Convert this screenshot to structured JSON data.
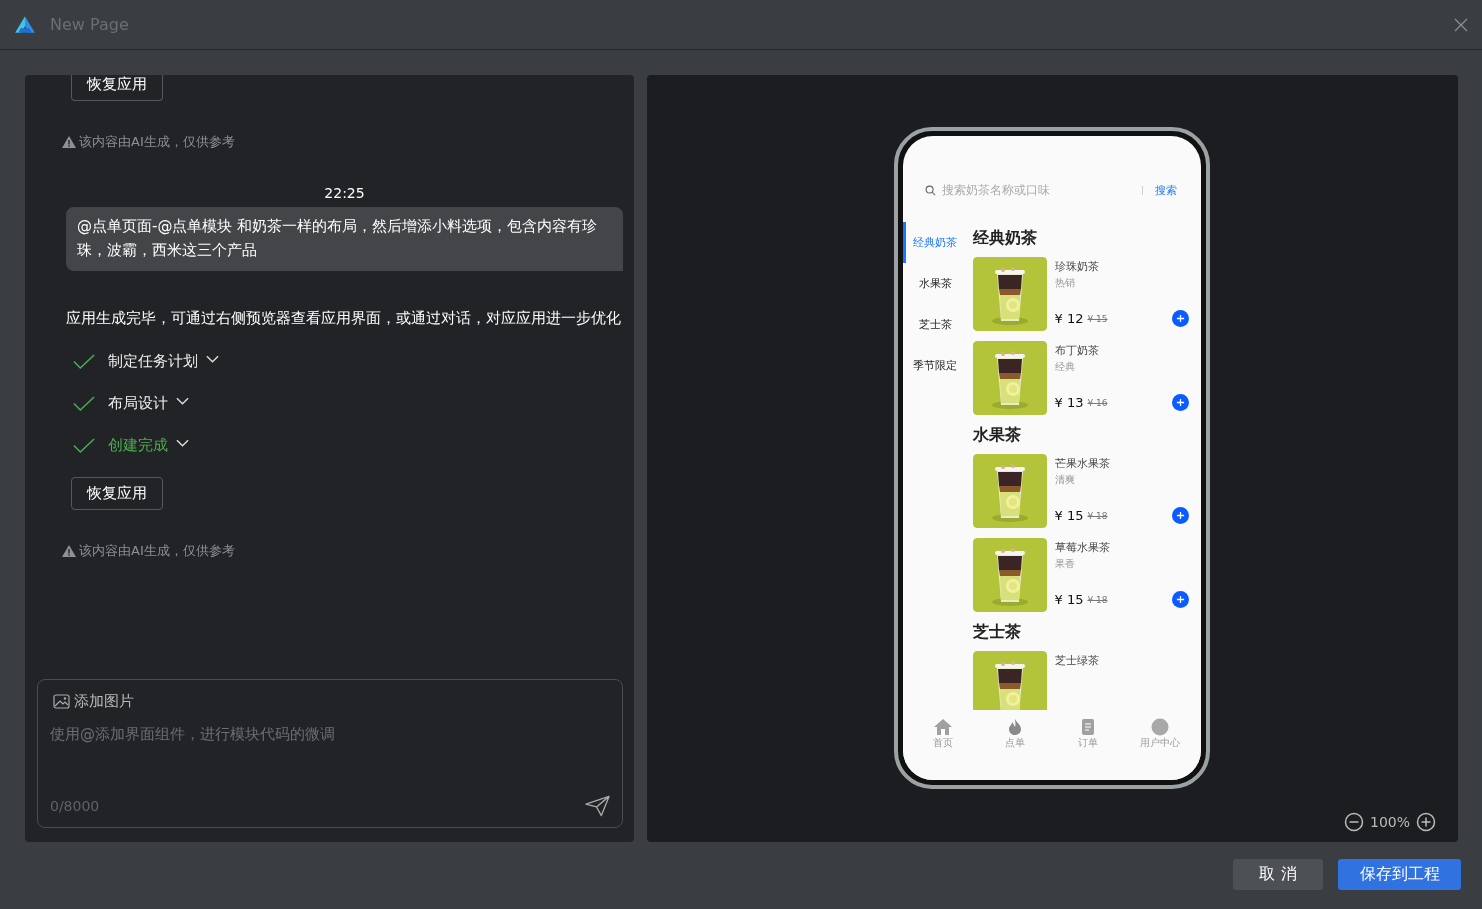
{
  "window": {
    "title": "New Page"
  },
  "chat": {
    "messages": [
      {
        "kind": "restore",
        "label": "恢复应用"
      },
      {
        "kind": "notice",
        "text": "该内容由AI生成，仅供参考"
      },
      {
        "kind": "time",
        "text": "22:25"
      },
      {
        "kind": "user",
        "text": "@点单页面-@点单模块 和奶茶一样的布局，然后增添小料选项，包含内容有珍珠，波霸，西米这三个产品"
      },
      {
        "kind": "reply",
        "text": "应用生成完毕，可通过右侧预览器查看应用界面，或通过对话，对应应用进一步优化"
      },
      {
        "kind": "step",
        "label": "制定任务计划",
        "done": true,
        "active": false
      },
      {
        "kind": "step",
        "label": "布局设计",
        "done": true,
        "active": false
      },
      {
        "kind": "step",
        "label": "创建完成",
        "done": true,
        "active": true
      },
      {
        "kind": "restore",
        "label": "恢复应用"
      },
      {
        "kind": "notice",
        "text": "该内容由AI生成，仅供参考"
      }
    ]
  },
  "composer": {
    "attach_label": "添加图片",
    "placeholder": "使用@添加界面组件，进行模块代码的微调",
    "counter": "0/8000"
  },
  "preview": {
    "search": {
      "placeholder": "搜索奶茶名称或口味",
      "button": "搜索"
    },
    "categories": [
      {
        "label": "经典奶茶",
        "selected": true
      },
      {
        "label": "水果茶",
        "selected": false
      },
      {
        "label": "芝士茶",
        "selected": false
      },
      {
        "label": "季节限定",
        "selected": false
      }
    ],
    "sections": [
      {
        "title": "经典奶茶",
        "products": [
          {
            "name": "珍珠奶茶",
            "tag": "热销",
            "price": "¥ 12",
            "old_price": "¥ 15"
          },
          {
            "name": "布丁奶茶",
            "tag": "经典",
            "price": "¥ 13",
            "old_price": "¥ 16"
          }
        ]
      },
      {
        "title": "水果茶",
        "products": [
          {
            "name": "芒果水果茶",
            "tag": "清爽",
            "price": "¥ 15",
            "old_price": "¥ 18"
          },
          {
            "name": "草莓水果茶",
            "tag": "果香",
            "price": "¥ 15",
            "old_price": "¥ 18"
          }
        ]
      },
      {
        "title": "芝士茶",
        "products": [
          {
            "name": "芝士绿茶"
          }
        ]
      }
    ],
    "tab_bar": [
      {
        "label": "首页"
      },
      {
        "label": "点单"
      },
      {
        "label": "订单"
      },
      {
        "label": "用户中心"
      }
    ],
    "zoom": "100%"
  },
  "footer": {
    "cancel": "取 消",
    "save": "保存到工程"
  }
}
